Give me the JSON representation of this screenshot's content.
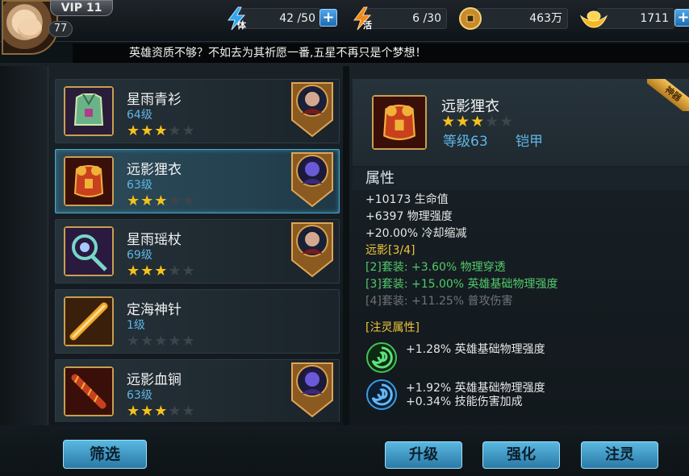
{
  "player": {
    "vip_label": "VIP 11",
    "level": "77"
  },
  "resources": {
    "stamina": {
      "icon_char": "体",
      "value": "42 /50"
    },
    "vitality": {
      "icon_char": "活",
      "value": "6 /30"
    },
    "coins": {
      "value": "463万"
    },
    "gold": {
      "value": "1711"
    }
  },
  "message": "英雄资质不够？不如去为其祈愿一番,五星不再只是个梦想！",
  "items": [
    {
      "name": "星雨青衫",
      "level": "64级",
      "stars": 3,
      "has_hero": true
    },
    {
      "name": "远影狸衣",
      "level": "63级",
      "stars": 3,
      "has_hero": true
    },
    {
      "name": "星雨瑶杖",
      "level": "69级",
      "stars": 3,
      "has_hero": true
    },
    {
      "name": "定海神针",
      "level": "1级",
      "stars": 0,
      "has_hero": false
    },
    {
      "name": "远影血锏",
      "level": "63级",
      "stars": 3,
      "has_hero": true
    }
  ],
  "detail": {
    "badge": "神器",
    "name": "远影狸衣",
    "stars": 3,
    "level": "等级63",
    "type": "铠甲",
    "attr_header": "属性",
    "attrs": [
      "+10173 生命值",
      "+6397 物理强度",
      "+20.00% 冷却缩减"
    ],
    "set_title": "远影[3/4]",
    "set_bonuses": [
      "[2]套装: +3.60% 物理穿透",
      "[3]套装: +15.00% 英雄基础物理强度",
      "[4]套装: +11.25% 普攻伤害"
    ],
    "spirit_title": "[注灵属性]",
    "spirit": [
      {
        "lines": [
          "+1.28% 英雄基础物理强度"
        ]
      },
      {
        "lines": [
          "+1.92% 英雄基础物理强度",
          "+0.34% 技能伤害加成"
        ]
      }
    ]
  },
  "buttons": {
    "filter": "筛选",
    "upgrade": "升级",
    "enhance": "强化",
    "infuse": "注灵"
  },
  "colors": {
    "accent": "#5fb6e6",
    "star": "#f6c21a",
    "set_active": "#52c96b",
    "set_inactive": "#6e7479",
    "gold_text": "#f0c43a"
  }
}
